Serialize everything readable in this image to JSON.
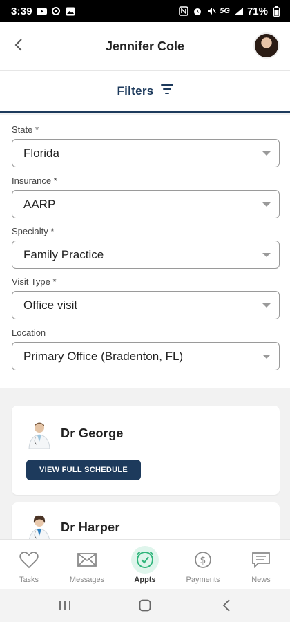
{
  "status_bar": {
    "time": "3:39",
    "network": "5G",
    "battery": "71%"
  },
  "header": {
    "title": "Jennifer Cole",
    "back_icon": "chevron-left-icon",
    "avatar_icon": "user-avatar"
  },
  "filters": {
    "label": "Filters",
    "icon": "filter-lines-icon",
    "accent_color": "#1d3a5c"
  },
  "form": {
    "state": {
      "label": "State *",
      "value": "Florida"
    },
    "insurance": {
      "label": "Insurance *",
      "value": "AARP"
    },
    "specialty": {
      "label": "Specialty *",
      "value": "Family Practice"
    },
    "visit_type": {
      "label": "Visit Type *",
      "value": "Office visit"
    },
    "location": {
      "label": "Location",
      "value": "Primary Office (Bradenton, FL)"
    }
  },
  "doctors": [
    {
      "name": "Dr George",
      "button_label": "VIEW FULL SCHEDULE"
    },
    {
      "name": "Dr Harper"
    }
  ],
  "tabs": [
    {
      "label": "Tasks",
      "icon": "heart-icon"
    },
    {
      "label": "Messages",
      "icon": "envelope-icon"
    },
    {
      "label": "Appts",
      "icon": "clock-check-icon",
      "active": true,
      "active_color": "#dff5ec"
    },
    {
      "label": "Payments",
      "icon": "dollar-circle-icon"
    },
    {
      "label": "News",
      "icon": "chat-bubble-icon"
    }
  ],
  "system_nav": {
    "recent_icon": "recent-apps-icon",
    "home_icon": "home-icon",
    "back_icon": "back-icon"
  }
}
